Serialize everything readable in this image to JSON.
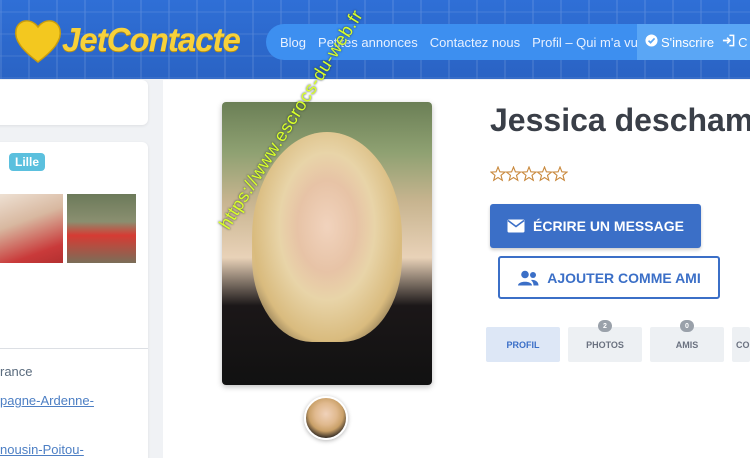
{
  "header": {
    "logo_text": "JetContacte",
    "nav": [
      "Blog",
      "Petites annonces",
      "Contactez nous",
      "Profil – Qui m'a vu"
    ],
    "signup_label": "S'inscrire",
    "login_label": "C"
  },
  "sidebar": {
    "city_tag": "Lille",
    "country_text": "rance",
    "region1_text": "pagne-Ardenne-",
    "region2_text": "nousin-Poitou-"
  },
  "profile": {
    "name": "Jessica deschamp",
    "watermark": "https://www.escrocs-du-web.fr",
    "rating": 0,
    "rating_max": 5,
    "message_button": "ÉCRIRE UN MESSAGE",
    "friend_button": "AJOUTER COMME AMI",
    "tabs": [
      {
        "label": "PROFIL",
        "badge": ""
      },
      {
        "label": "PHOTOS",
        "badge": "2"
      },
      {
        "label": "AMIS",
        "badge": "0"
      },
      {
        "label": "CON",
        "badge": ""
      }
    ]
  },
  "colors": {
    "brand_blue": "#3b6fc7",
    "logo_yellow": "#f7d13b",
    "tag_blue": "#5bc0de"
  }
}
